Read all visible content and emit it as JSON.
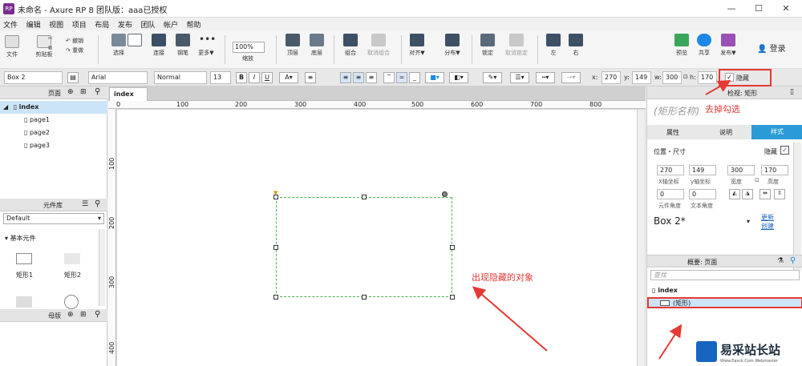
{
  "window": {
    "app_icon_text": "RP",
    "title": "未命名 - Axure RP 8 团队版：aaa已授权",
    "min": "—",
    "max": "☐",
    "close": "✕"
  },
  "menu": [
    "文件",
    "编辑",
    "视图",
    "项目",
    "布局",
    "发布",
    "团队",
    "帐户",
    "帮助"
  ],
  "toolbar": {
    "file": "文件",
    "clipboard": "剪贴板",
    "cut": "剪切",
    "copy": "复制",
    "undo": "撤销",
    "redo": "重做",
    "select": "选择",
    "connect": "连接",
    "pen": "钢笔",
    "more": "更多▼",
    "zoom_value": "100%",
    "zoom_label": "缩放",
    "top": "顶层",
    "bottom": "底层",
    "group": "组合",
    "ungroup": "取消组合",
    "align": "对齐▼",
    "distribute": "分布▼",
    "lock": "锁定",
    "unlock": "取消锁定",
    "left": "左",
    "right": "右",
    "preview": "预览",
    "share": "共享",
    "publish": "发布▼",
    "login": "登录",
    "colors": {
      "preview": "#3aa65a",
      "share": "#1e88e5",
      "publish": "#9c4fb5"
    }
  },
  "propbar": {
    "widget_name": "Box 2",
    "font": "Arial",
    "style": "Normal",
    "size": "13",
    "bold": "B",
    "italic": "I",
    "underline": "U",
    "x_label": "x:",
    "x": "270",
    "y_label": "y:",
    "y": "149",
    "w_label": "w:",
    "w": "300",
    "h_label": "h:",
    "h": "170",
    "hidden_check": "✓",
    "hidden_label": "隐藏"
  },
  "pages_panel": {
    "title": "页面",
    "root": "index",
    "pages": [
      "page1",
      "page2",
      "page3"
    ]
  },
  "library_panel": {
    "title": "元件库",
    "selected": "Default",
    "group": "基本元件",
    "items": [
      "矩形1",
      "矩形2"
    ]
  },
  "masters_panel": {
    "title": "母版"
  },
  "canvas": {
    "tab": "index",
    "tab_close": "×",
    "ruler_top": [
      "0",
      "100",
      "200",
      "300",
      "400",
      "500",
      "600",
      "700",
      "800"
    ],
    "ruler_left": [
      "100",
      "200",
      "300",
      "400"
    ],
    "annotation": "出现隐藏的对象",
    "annotation_color": "#e53935",
    "selection_color": "#4caf50"
  },
  "inspector": {
    "header": "检视: 矩形",
    "name_placeholder": "(矩形名称)",
    "annotation": "去掉勾选",
    "tabs": [
      "属性",
      "说明",
      "样式"
    ],
    "pos_size": "位置・尺寸",
    "hidden": "隐藏",
    "x": "270",
    "y": "149",
    "w": "300",
    "h": "170",
    "x_label": "X轴坐标",
    "y_label": "y轴坐标",
    "w_label": "宽度",
    "h_label": "高度",
    "rot": "0",
    "rot_label": "元件角度",
    "text_rot": "0",
    "text_rot_label": "文本角度",
    "style_name": "Box 2*",
    "update": "更新",
    "create": "创建"
  },
  "outline": {
    "title": "概要: 页面",
    "search_placeholder": "查找",
    "page": "index",
    "item": "(矩形)"
  },
  "watermark": {
    "text": "易采站长站",
    "sub": "Www.Easck.Com  Webmaster"
  }
}
